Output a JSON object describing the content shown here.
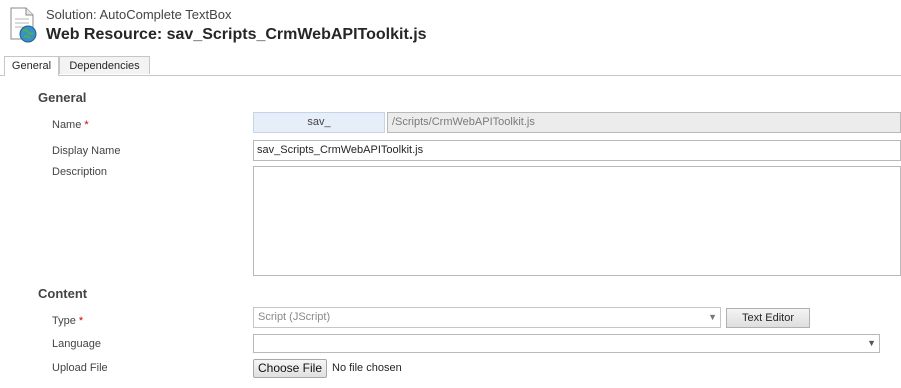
{
  "header": {
    "solution_text": "Solution: AutoComplete TextBox",
    "title": "Web Resource: sav_Scripts_CrmWebAPIToolkit.js",
    "icon": "document-globe-icon"
  },
  "tabs": [
    {
      "label": "General",
      "active": true
    },
    {
      "label": "Dependencies",
      "active": false
    }
  ],
  "general": {
    "section_title": "General",
    "name_label": "Name",
    "required_marker": "*",
    "name_prefix": "sav_",
    "name_value": "/Scripts/CrmWebAPIToolkit.js",
    "display_name_label": "Display Name",
    "display_name_value": "sav_Scripts_CrmWebAPIToolkit.js",
    "description_label": "Description",
    "description_value": ""
  },
  "content": {
    "section_title": "Content",
    "type_label": "Type",
    "type_value": "Script (JScript)",
    "text_editor_button": "Text Editor",
    "language_label": "Language",
    "language_value": "",
    "upload_label": "Upload File",
    "choose_file_button": "Choose File",
    "no_file_text": "No file chosen"
  },
  "colors": {
    "required": "#cc0000",
    "prefix_bg": "#e6eefa",
    "readonly_bg": "#ececec"
  }
}
